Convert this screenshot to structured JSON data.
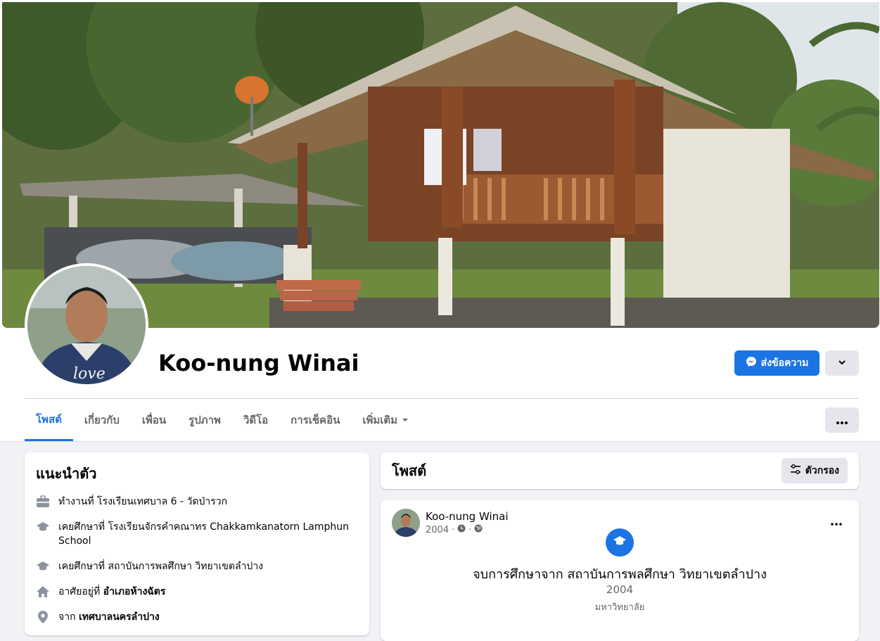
{
  "profile": {
    "name": "Koo-nung Winai"
  },
  "actions": {
    "message_label": "ส่งข้อความ"
  },
  "tabs": [
    {
      "label": "โพสต์"
    },
    {
      "label": "เกี่ยวกับ"
    },
    {
      "label": "เพื่อน"
    },
    {
      "label": "รูปภาพ"
    },
    {
      "label": "วิดีโอ"
    },
    {
      "label": "การเช็คอิน"
    },
    {
      "label": "เพิ่มเติม"
    }
  ],
  "tab_more_icon": "ellipsis-icon",
  "intro": {
    "title": "แนะนำตัว",
    "items": [
      {
        "icon": "briefcase-icon",
        "text": "ทำงานที่ โรงเรียนเทศบาล 6 - วัดป่ารวก"
      },
      {
        "icon": "graduation-cap-icon",
        "text": "เคยศึกษาที่ โรงเรียนจักรคำคณาทร Chakkamkanatorn Lamphun School"
      },
      {
        "icon": "graduation-cap-icon",
        "text": "เคยศึกษาที่ สถาบันการพลศึกษา วิทยาเขตลำปาง"
      },
      {
        "icon": "home-icon",
        "prefix": "อาศัยอยู่ที่ ",
        "bold": "อำเภอห้างฉัตร"
      },
      {
        "icon": "location-pin-icon",
        "prefix": "จาก ",
        "bold": "เทศบาลนครลำปาง"
      }
    ]
  },
  "posts": {
    "title": "โพสต์",
    "filter_label": "ตัวกรอง"
  },
  "post": {
    "author": "Koo-nung Winai",
    "year": "2004",
    "title": "จบการศึกษาจาก สถาบันการพลศึกษา วิทยาเขตลำปาง",
    "body_year": "2004",
    "type": "มหาวิทยาลัย"
  },
  "colors": {
    "accent": "#1b74e4",
    "background": "#f0f2f5",
    "button_gray": "#e4e6eb",
    "secondary_text": "#65676b"
  }
}
